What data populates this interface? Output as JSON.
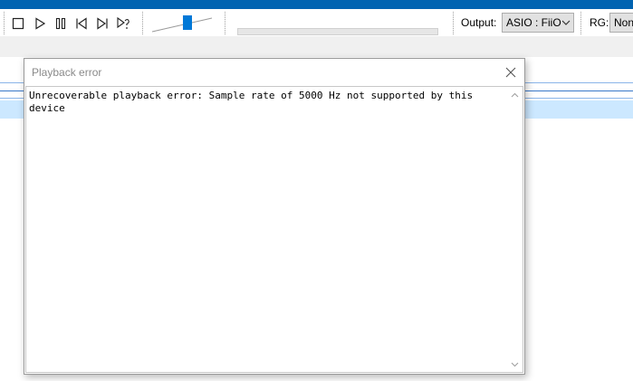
{
  "toolbar": {
    "buttons": [
      {
        "icon": "stop-icon"
      },
      {
        "icon": "play-icon"
      },
      {
        "icon": "pause-icon"
      },
      {
        "icon": "previous-icon"
      },
      {
        "icon": "next-icon"
      },
      {
        "icon": "random-icon"
      }
    ],
    "output_label": "Output:",
    "output_value": "ASIO : FiiO",
    "rg_label": "RG:",
    "rg_value": "None"
  },
  "dialog": {
    "title": "Playback error",
    "message": "Unrecoverable playback error: Sample rate of 5000 Hz not supported by this device"
  },
  "colors": {
    "accent": "#0063b1",
    "selection": "#cce8ff",
    "slider_thumb": "#0078d7"
  }
}
